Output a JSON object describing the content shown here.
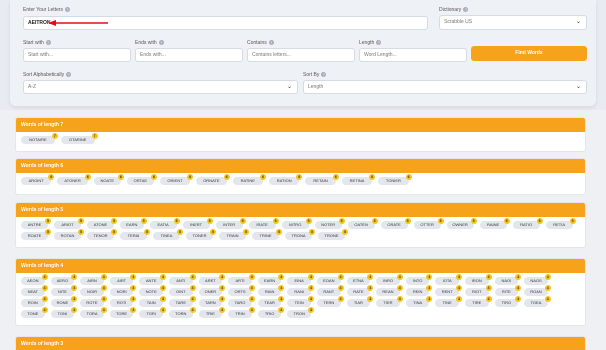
{
  "form": {
    "letters_label": "Enter Your Letters",
    "letters_value": "AEITRON",
    "dictionary_label": "Dictionary",
    "dictionary_value": "Scrabble US",
    "start_label": "Start with",
    "start_placeholder": "Start with...",
    "end_label": "Ends with",
    "end_placeholder": "Ends with...",
    "contains_label": "Contains",
    "contains_placeholder": "Contains letters...",
    "length_label": "Length",
    "length_placeholder": "Word Length...",
    "find_label": "Find Words",
    "sort_alpha_label": "Sort Alphabetically",
    "sort_alpha_value": "A-Z",
    "sort_by_label": "Sort By",
    "sort_by_value": "Length"
  },
  "sections": [
    {
      "title": "Words of length 7",
      "words": [
        {
          "w": "NOTAIRE",
          "p": "7"
        },
        {
          "w": "OTARINE",
          "p": "7"
        }
      ]
    },
    {
      "title": "Words of length 6",
      "words": [
        {
          "w": "AROINT",
          "p": "6"
        },
        {
          "w": "ATONER",
          "p": "6"
        },
        {
          "w": "NOATE",
          "p": "6"
        },
        {
          "w": "ORTAE",
          "p": "6"
        },
        {
          "w": "ORIENT",
          "p": "6"
        },
        {
          "w": "ORNATE",
          "p": "6"
        },
        {
          "w": "RATINE",
          "p": "6"
        },
        {
          "w": "RATION",
          "p": "6"
        },
        {
          "w": "RETAIN",
          "p": "6"
        },
        {
          "w": "RETINA",
          "p": "6"
        },
        {
          "w": "TONIER",
          "p": "6"
        }
      ]
    },
    {
      "title": "Words of length 5",
      "words": [
        {
          "w": "ANTRE",
          "p": "5"
        },
        {
          "w": "ARIOT",
          "p": "5"
        },
        {
          "w": "ATONE",
          "p": "5"
        },
        {
          "w": "EARN",
          "p": "5"
        },
        {
          "w": "EATIA",
          "p": "5"
        },
        {
          "w": "INERT",
          "p": "5"
        },
        {
          "w": "INTER",
          "p": "5"
        },
        {
          "w": "IRATE",
          "p": "5"
        },
        {
          "w": "NITRO",
          "p": "5"
        },
        {
          "w": "NOTER",
          "p": "5"
        },
        {
          "w": "OATEN",
          "p": "5"
        },
        {
          "w": "ORATE",
          "p": "5"
        },
        {
          "w": "OTTER",
          "p": "5"
        },
        {
          "w": "OWNER",
          "p": "5"
        },
        {
          "w": "RAINE",
          "p": "5"
        },
        {
          "w": "RATIO",
          "p": "5"
        },
        {
          "w": "RETIA",
          "p": "5"
        },
        {
          "w": "ROATE",
          "p": "5"
        },
        {
          "w": "ROTAN",
          "p": "5"
        },
        {
          "w": "TENOR",
          "p": "5"
        },
        {
          "w": "TERAI",
          "p": "5"
        },
        {
          "w": "TINEA",
          "p": "5"
        },
        {
          "w": "TONER",
          "p": "5"
        },
        {
          "w": "TRAIN",
          "p": "5"
        },
        {
          "w": "TRINE",
          "p": "5"
        },
        {
          "w": "TRONA",
          "p": "5"
        },
        {
          "w": "TRONE",
          "p": "5"
        }
      ]
    },
    {
      "title": "Words of length 4",
      "words": [
        {
          "w": "AEON",
          "p": "4"
        },
        {
          "w": "AERO",
          "p": "4"
        },
        {
          "w": "AIRN",
          "p": "4"
        },
        {
          "w": "AIRT",
          "p": "4"
        },
        {
          "w": "ANTE",
          "p": "4"
        },
        {
          "w": "ANTI",
          "p": "4"
        },
        {
          "w": "ARET",
          "p": "4"
        },
        {
          "w": "ARTI",
          "p": "4"
        },
        {
          "w": "EARN",
          "p": "4"
        },
        {
          "w": "EINA",
          "p": "4"
        },
        {
          "w": "EOAN",
          "p": "4"
        },
        {
          "w": "ETNA",
          "p": "4"
        },
        {
          "w": "INRO",
          "p": "4"
        },
        {
          "w": "INTO",
          "p": "4"
        },
        {
          "w": "IOTA",
          "p": "4"
        },
        {
          "w": "IRON",
          "p": "4"
        },
        {
          "w": "NAOI",
          "p": "4"
        },
        {
          "w": "NAOS",
          "p": "4"
        },
        {
          "w": "NEAT",
          "p": "4"
        },
        {
          "w": "NITE",
          "p": "4"
        },
        {
          "w": "NOIR",
          "p": "4"
        },
        {
          "w": "NORI",
          "p": "4"
        },
        {
          "w": "NOTE",
          "p": "4"
        },
        {
          "w": "OINT",
          "p": "4"
        },
        {
          "w": "ONER",
          "p": "4"
        },
        {
          "w": "ORTS",
          "p": "4"
        },
        {
          "w": "RAIN",
          "p": "4"
        },
        {
          "w": "RANI",
          "p": "4"
        },
        {
          "w": "RANT",
          "p": "4"
        },
        {
          "w": "RATE",
          "p": "4"
        },
        {
          "w": "REAN",
          "p": "4"
        },
        {
          "w": "REIN",
          "p": "4"
        },
        {
          "w": "RENT",
          "p": "4"
        },
        {
          "w": "RIOT",
          "p": "4"
        },
        {
          "w": "RITE",
          "p": "4"
        },
        {
          "w": "ROAN",
          "p": "4"
        },
        {
          "w": "ROIN",
          "p": "4"
        },
        {
          "w": "RONE",
          "p": "4"
        },
        {
          "w": "ROTE",
          "p": "4"
        },
        {
          "w": "ROTI",
          "p": "4"
        },
        {
          "w": "TAIN",
          "p": "4"
        },
        {
          "w": "TARE",
          "p": "4"
        },
        {
          "w": "TARN",
          "p": "4"
        },
        {
          "w": "TARO",
          "p": "4"
        },
        {
          "w": "TEAR",
          "p": "4"
        },
        {
          "w": "TEIN",
          "p": "4"
        },
        {
          "w": "TERN",
          "p": "4"
        },
        {
          "w": "TIAR",
          "p": "4"
        },
        {
          "w": "TIER",
          "p": "4"
        },
        {
          "w": "TINA",
          "p": "4"
        },
        {
          "w": "TINE",
          "p": "4"
        },
        {
          "w": "TIRE",
          "p": "4"
        },
        {
          "w": "TIRO",
          "p": "4"
        },
        {
          "w": "TOEA",
          "p": "4"
        },
        {
          "w": "TONE",
          "p": "4"
        },
        {
          "w": "TONI",
          "p": "4"
        },
        {
          "w": "TORA",
          "p": "4"
        },
        {
          "w": "TORE",
          "p": "4"
        },
        {
          "w": "TORI",
          "p": "4"
        },
        {
          "w": "TORN",
          "p": "4"
        },
        {
          "w": "TRIE",
          "p": "4"
        },
        {
          "w": "TRIN",
          "p": "4"
        },
        {
          "w": "TRIO",
          "p": "4"
        },
        {
          "w": "TRON",
          "p": "4"
        }
      ]
    },
    {
      "title": "Words of length 3",
      "words": []
    }
  ]
}
